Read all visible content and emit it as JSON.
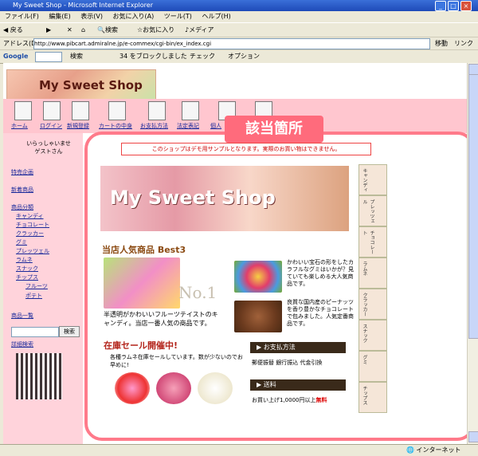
{
  "window": {
    "title": "My Sweet Shop - Microsoft Internet Explorer"
  },
  "menu": [
    "ファイル(F)",
    "編集(E)",
    "表示(V)",
    "お気に入り(A)",
    "ツール(T)",
    "ヘルプ(H)"
  ],
  "toolbar": {
    "back": "戻る",
    "search": "検索",
    "favorites": "お気に入り",
    "media": "メディア"
  },
  "address": {
    "label": "アドレス(D)",
    "url": "http://www.pibcart.admiralne.jp/e-commex/cgi-bin/ex_index.cgi",
    "go": "移動",
    "links": "リンク"
  },
  "google": {
    "label": "Google",
    "search": "検索",
    "blocked": "34 をブロックしました",
    "check": "チェック",
    "options": "オプション"
  },
  "site": {
    "logo": "My Sweet Shop",
    "nav": [
      "ホーム",
      "ログイン",
      "新規登録",
      "カートの中身",
      "お支払方法",
      "法定表記",
      "個人"
    ],
    "welcome": [
      "いらっしゃいませ",
      "ゲストさん"
    ],
    "side_links": [
      "特売企画",
      "新着商品",
      "商品分類",
      "キャンディ",
      "チョコレート",
      "クラッカー",
      "グミ",
      "プレッツェル",
      "ラムネ",
      "スナック",
      "チップス",
      "フルーツ",
      "ポテト",
      "商品一覧",
      "詳細検索"
    ],
    "search_button": "検索",
    "callout": "該当箇所",
    "notice": "このショップはデモ用サンプルとなります。実際のお買い物はできません。",
    "banner": "My Sweet Shop",
    "categories": [
      "キャンディ",
      "プレッツェル",
      "チョコレート",
      "ラムネ",
      "クラッカー",
      "スナック",
      "グミ",
      "チップス"
    ],
    "best_title": "当店人気商品 Best3",
    "no1": "No.1",
    "item1_desc": "半透明がかわいいフルーツテイストのキャンディ。当店一番人気の商品です。",
    "item2_desc": "かわいい宝石の形をしたカラフルなグミはいかが？見ていても楽しめる大人気商品です。",
    "item3_desc": "良質な国内産のピーナッツを香り豊かなチョコレートで包みました。人気定番商品です。",
    "sale_title": "在庫セール開催中!",
    "sale_desc": "各種ラムネ在庫セールしています。数が少ないのでお早めに!",
    "payment_title": "お支払方法",
    "payment_desc": "郵便振替 銀行振込 代金引換",
    "shipping_title": "送料",
    "shipping_desc": "お買い上げ1,0000円以上",
    "shipping_free": "無料"
  },
  "status": {
    "zone": "インターネット"
  }
}
